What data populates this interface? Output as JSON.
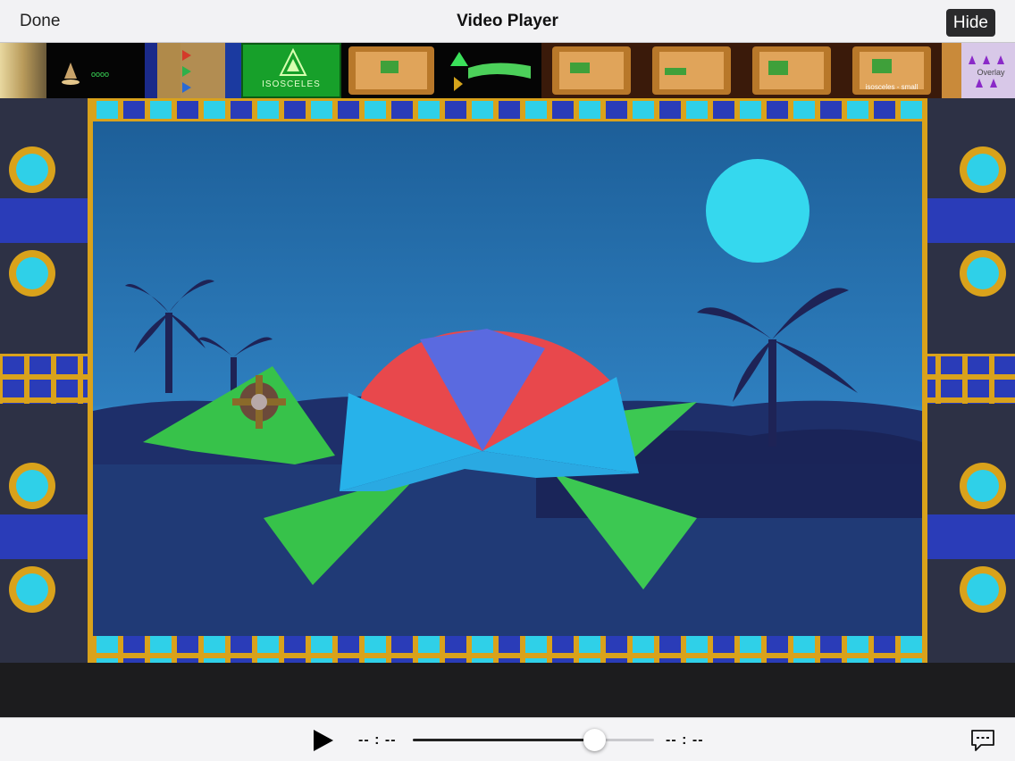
{
  "nav": {
    "done_label": "Done",
    "title": "Video Player",
    "hide_label": "Hide"
  },
  "filmstrip": {
    "thumbnails": [
      {
        "label": ""
      },
      {
        "label": "oooo"
      },
      {
        "label": ""
      },
      {
        "label": "ISOSCELES"
      },
      {
        "label": ""
      },
      {
        "label": ""
      },
      {
        "label": ""
      },
      {
        "label": ""
      },
      {
        "label": ""
      },
      {
        "label": "isosceles - small"
      },
      {
        "label": "Overlay"
      }
    ]
  },
  "player": {
    "elapsed_time": "-- : --",
    "remaining_time": "-- : --",
    "progress": 0.75,
    "play_icon": "play-icon",
    "captions_icon": "captions-icon"
  },
  "colors": {
    "accent_gold": "#d9a21b",
    "tile_cyan": "#2fd0e8",
    "tile_blue": "#2a3cb8",
    "sky": "#2c77b8"
  }
}
